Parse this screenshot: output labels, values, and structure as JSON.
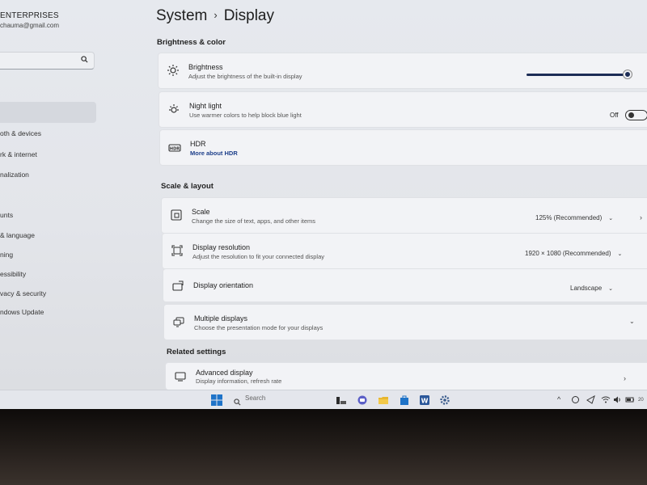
{
  "sidebar": {
    "account_name": "ENTERPRISES",
    "account_email": "chauma@gmail.com",
    "items": [
      {
        "label": "oth & devices"
      },
      {
        "label": "rk & internet"
      },
      {
        "label": "nalization"
      },
      {
        "label": "unts"
      },
      {
        "label": "& language"
      },
      {
        "label": "ning"
      },
      {
        "label": "essibility"
      },
      {
        "label": "vacy & security"
      },
      {
        "label": "ndows Update"
      }
    ]
  },
  "header": {
    "breadcrumb_parent": "System",
    "breadcrumb_separator": "›",
    "breadcrumb_current": "Display"
  },
  "brightness_color": {
    "heading": "Brightness & color",
    "brightness": {
      "title": "Brightness",
      "subtitle": "Adjust the brightness of the built-in display",
      "level_percent": 100
    },
    "night_light": {
      "title": "Night light",
      "subtitle": "Use warmer colors to help block blue light",
      "state": "Off"
    },
    "hdr": {
      "title": "HDR",
      "link": "More about HDR"
    }
  },
  "scale_layout": {
    "heading": "Scale & layout",
    "scale": {
      "title": "Scale",
      "subtitle": "Change the size of text, apps, and other items",
      "value": "125% (Recommended)"
    },
    "resolution": {
      "title": "Display resolution",
      "subtitle": "Adjust the resolution to fit your connected display",
      "value": "1920 × 1080 (Recommended)"
    },
    "orientation": {
      "title": "Display orientation",
      "value": "Landscape"
    },
    "multiple": {
      "title": "Multiple displays",
      "subtitle": "Choose the presentation mode for your displays"
    }
  },
  "related": {
    "heading": "Related settings",
    "advanced": {
      "title": "Advanced display",
      "subtitle": "Display information, refresh rate"
    }
  },
  "taskbar": {
    "search_placeholder": "Search",
    "clock": "20"
  },
  "colors": {
    "accent": "#1d2d56",
    "link": "#1d3f8a",
    "windows_logo": "#1e73c8"
  }
}
